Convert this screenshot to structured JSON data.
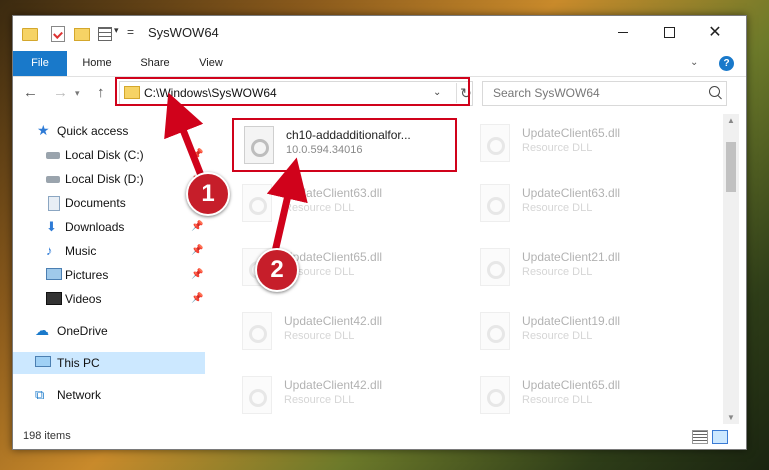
{
  "window": {
    "title": "SysWOW64",
    "minimize_label": "",
    "maximize_label": "",
    "close_label": "✕"
  },
  "ribbon": {
    "tabs": [
      "File",
      "Home",
      "Share",
      "View"
    ],
    "help": "?"
  },
  "address": {
    "path": "C:\\Windows\\SysWOW64",
    "search_placeholder": "Search SysWOW64"
  },
  "nav_pane": {
    "items": [
      {
        "label": "Quick access",
        "icon": "star-icon",
        "pinned": false
      },
      {
        "label": "Local Disk (C:)",
        "icon": "disk-icon",
        "pinned": true
      },
      {
        "label": "Local Disk (D:)",
        "icon": "disk-icon",
        "pinned": true
      },
      {
        "label": "Documents",
        "icon": "documents-icon",
        "pinned": true
      },
      {
        "label": "Downloads",
        "icon": "download-icon",
        "pinned": true
      },
      {
        "label": "Music",
        "icon": "music-icon",
        "pinned": true
      },
      {
        "label": "Pictures",
        "icon": "pictures-icon",
        "pinned": true
      },
      {
        "label": "Videos",
        "icon": "videos-icon",
        "pinned": true
      },
      {
        "label": "OneDrive",
        "icon": "cloud-icon",
        "pinned": false
      },
      {
        "label": "This PC",
        "icon": "computer-icon",
        "pinned": false,
        "selected": true
      },
      {
        "label": "Network",
        "icon": "network-icon",
        "pinned": false
      }
    ]
  },
  "files": {
    "left_column": [
      {
        "name": "ch10-addadditionalfor...",
        "desc": "10.0.594.34016",
        "highlighted": true
      },
      {
        "name": "UpdateClient63.dll",
        "desc": "Resource DLL"
      },
      {
        "name": "UpdateClient65.dll",
        "desc": "Resource DLL"
      },
      {
        "name": "UpdateClient42.dll",
        "desc": "Resource DLL"
      },
      {
        "name": "UpdateClient42.dll",
        "desc": "Resource DLL"
      }
    ],
    "right_column": [
      {
        "name": "UpdateClient65.dll",
        "desc": "Resource DLL"
      },
      {
        "name": "UpdateClient63.dll",
        "desc": "Resource DLL"
      },
      {
        "name": "UpdateClient21.dll",
        "desc": "Resource DLL"
      },
      {
        "name": "UpdateClient19.dll",
        "desc": "Resource DLL"
      },
      {
        "name": "UpdateClient65.dll",
        "desc": "Resource DLL"
      }
    ]
  },
  "status": {
    "item_count": "198 items"
  },
  "annotations": {
    "badge1": "1",
    "badge2": "2",
    "color": "#d0021b"
  }
}
